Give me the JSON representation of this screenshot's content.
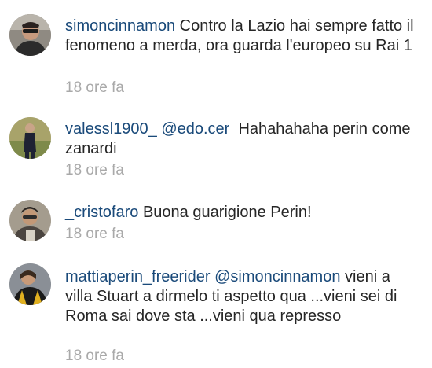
{
  "comments": [
    {
      "username": "simoncinnamon",
      "mention": "",
      "text": "Contro la Lazio hai sempre fatto il fenomeno a merda, ora guarda l'europeo su Rai 1",
      "time": "18 ore fa",
      "avatar_icon": "profile-photo-icon"
    },
    {
      "username": "valessl1900_",
      "mention": "@edo.cer",
      "text": "Hahahahaha perin come zanardi",
      "time": "18 ore fa",
      "avatar_icon": "profile-photo-icon"
    },
    {
      "username": "_cristofaro",
      "mention": "",
      "text": "Buona guarigione Perin!",
      "time": "18 ore fa",
      "avatar_icon": "profile-photo-icon"
    },
    {
      "username": "mattiaperin_freerider",
      "mention": "@simoncinnamon",
      "text": "vieni a villa Stuart a dirmelo ti aspetto qua ...vieni sei di Roma sai dove sta ...vieni qua represso",
      "time": "18 ore fa",
      "avatar_icon": "profile-photo-icon"
    }
  ],
  "colors": {
    "username": "#1a4a7a",
    "text": "#262626",
    "timestamp": "#a9a9a9"
  }
}
